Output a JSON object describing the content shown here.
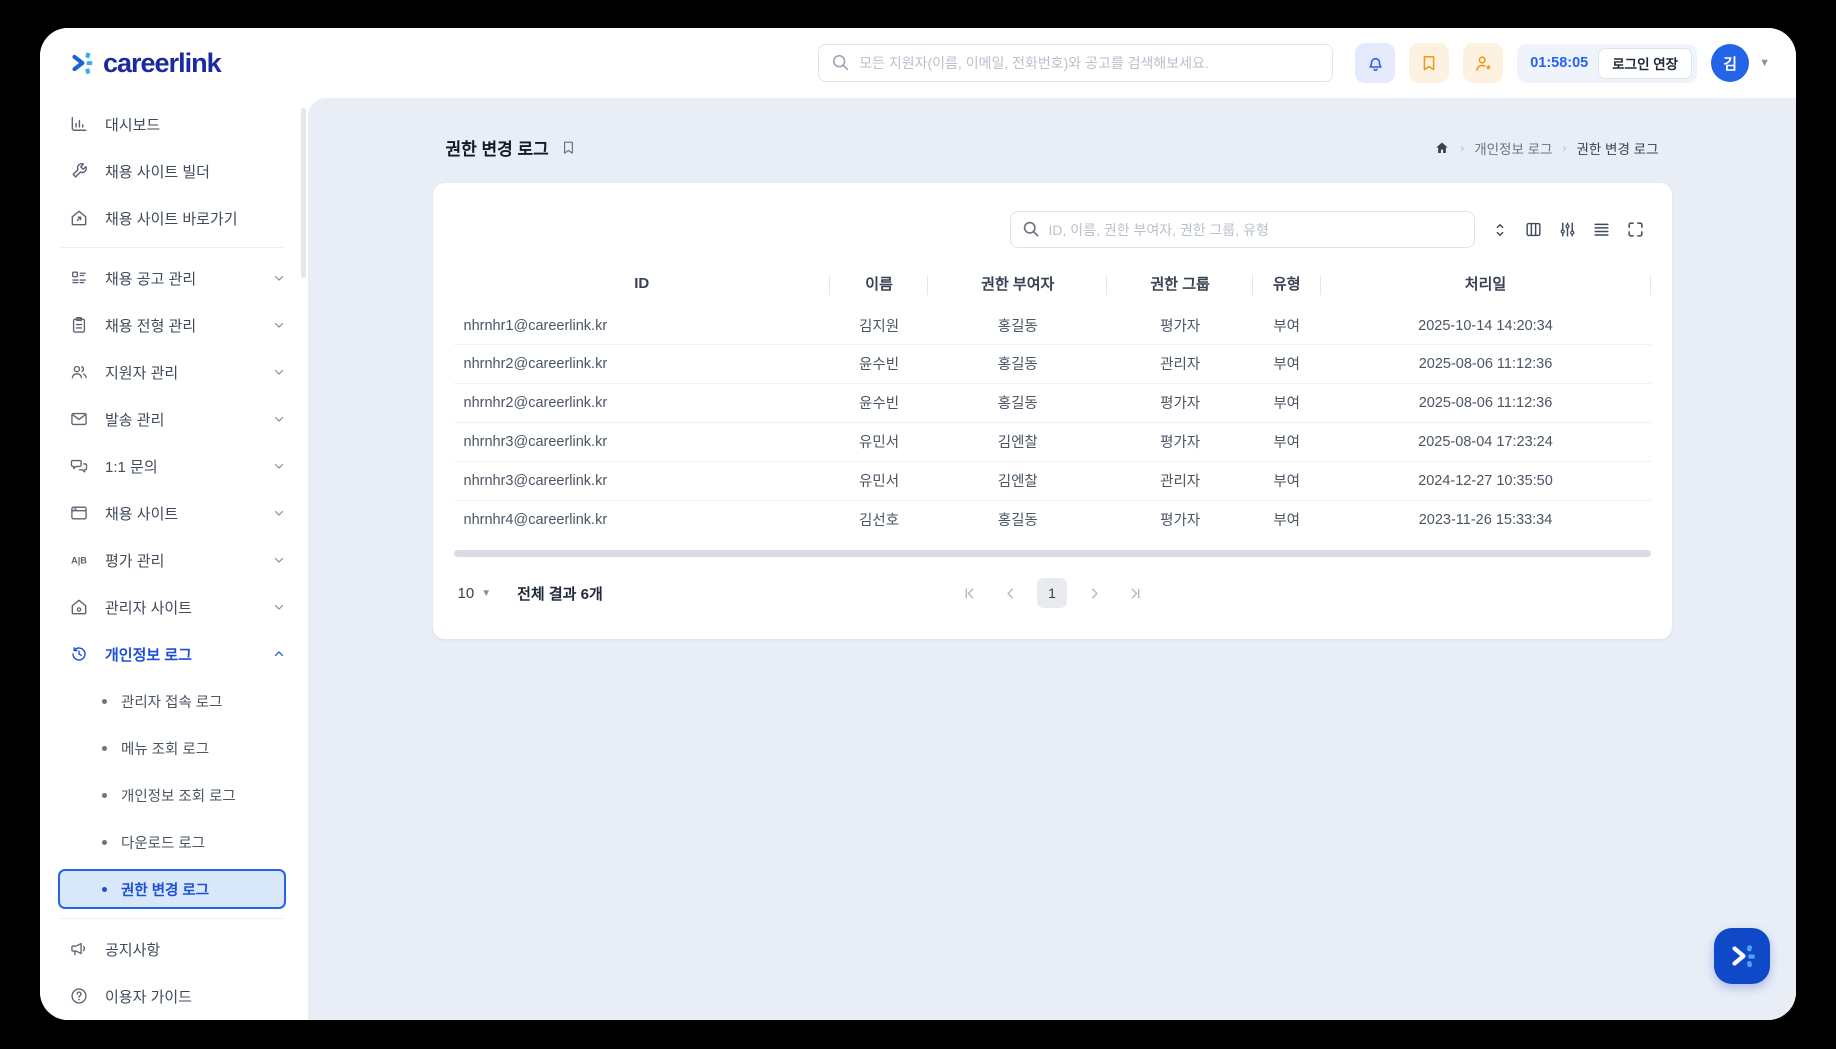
{
  "header": {
    "logo_text": "careerlink",
    "search_placeholder": "모든 지원자(이름, 이메일, 전화번호)와 공고를 검색해보세요.",
    "session_timer": "01:58:05",
    "extend_login_label": "로그인 연장",
    "avatar_initial": "김"
  },
  "sidebar": {
    "items": [
      {
        "label": "대시보드"
      },
      {
        "label": "채용 사이트 빌더"
      },
      {
        "label": "채용 사이트 바로가기"
      },
      {
        "label": "채용 공고 관리"
      },
      {
        "label": "채용 전형 관리"
      },
      {
        "label": "지원자 관리"
      },
      {
        "label": "발송 관리"
      },
      {
        "label": "1:1 문의"
      },
      {
        "label": "채용 사이트"
      },
      {
        "label": "평가 관리"
      },
      {
        "label": "관리자 사이트"
      },
      {
        "label": "개인정보 로그"
      }
    ],
    "sub_items": [
      {
        "label": "관리자 접속 로그"
      },
      {
        "label": "메뉴 조회 로그"
      },
      {
        "label": "개인정보 조회 로그"
      },
      {
        "label": "다운로드 로그"
      },
      {
        "label": "권한 변경 로그"
      }
    ],
    "footer_items": [
      {
        "label": "공지사항"
      },
      {
        "label": "이용자 가이드"
      }
    ]
  },
  "page": {
    "title": "권한 변경 로그",
    "breadcrumb": [
      "개인정보 로그",
      "권한 변경 로그"
    ]
  },
  "table": {
    "search_placeholder": "ID, 이름, 권한 부여자, 권한 그룹, 유형",
    "columns": [
      "ID",
      "이름",
      "권한 부여자",
      "권한 그룹",
      "유형",
      "처리일"
    ],
    "rows": [
      [
        "nhrnhr1@careerlink.kr",
        "김지원",
        "홍길동",
        "평가자",
        "부여",
        "2025-10-14 14:20:34"
      ],
      [
        "nhrnhr2@careerlink.kr",
        "윤수빈",
        "홍길동",
        "관리자",
        "부여",
        "2025-08-06 11:12:36"
      ],
      [
        "nhrnhr2@careerlink.kr",
        "윤수빈",
        "홍길동",
        "평가자",
        "부여",
        "2025-08-06 11:12:36"
      ],
      [
        "nhrnhr3@careerlink.kr",
        "유민서",
        "김엔찰",
        "평가자",
        "부여",
        "2025-08-04 17:23:24"
      ],
      [
        "nhrnhr3@careerlink.kr",
        "유민서",
        "김엔찰",
        "관리자",
        "부여",
        "2024-12-27 10:35:50"
      ],
      [
        "nhrnhr4@careerlink.kr",
        "김선호",
        "홍길동",
        "평가자",
        "부여",
        "2023-11-26 15:33:34"
      ]
    ]
  },
  "pagination": {
    "page_size": "10",
    "total_text": "전체 결과 6개",
    "current_page": "1"
  },
  "colors": {
    "primary_blue": "#2563eb",
    "logo_navy": "#1b2aa1",
    "logo_cyan": "#3aa9f8",
    "accent_orange": "#f0970e",
    "active_item_bg": "#d9e7fb",
    "main_bg": "#e9eef6",
    "fab_blue": "#1049c8"
  }
}
